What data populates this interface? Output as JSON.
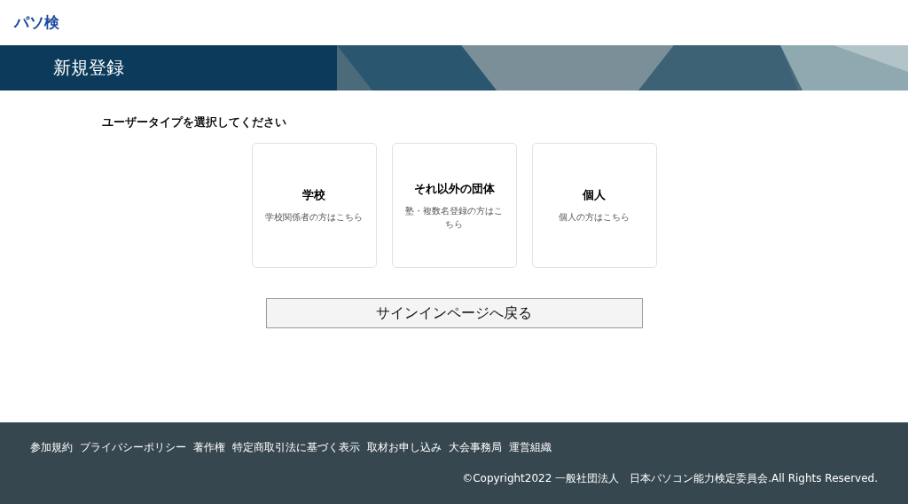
{
  "logo": "パソ検",
  "banner": {
    "title": "新規登録",
    "kind": "picture"
  },
  "prompt": "ユーザータイプを選択してください",
  "user_types": [
    {
      "title": "学校",
      "description": "学校関係者の方はこちら"
    },
    {
      "title": "それ以外の団体",
      "description": "塾・複数名登録の方はこちら"
    },
    {
      "title": "個人",
      "description": "個人の方はこちら"
    }
  ],
  "back_button": "サインインページへ戻る",
  "footer": {
    "links": [
      "参加規約",
      "プライバシーポリシー",
      "著作権",
      "特定商取引法に基づく表示",
      "取材お申し込み",
      "大会事務局",
      "運営組織"
    ],
    "copyright": "©Copyright2022 一般社団法人　日本パソコン能力検定委員会.All Rights Reserved."
  }
}
